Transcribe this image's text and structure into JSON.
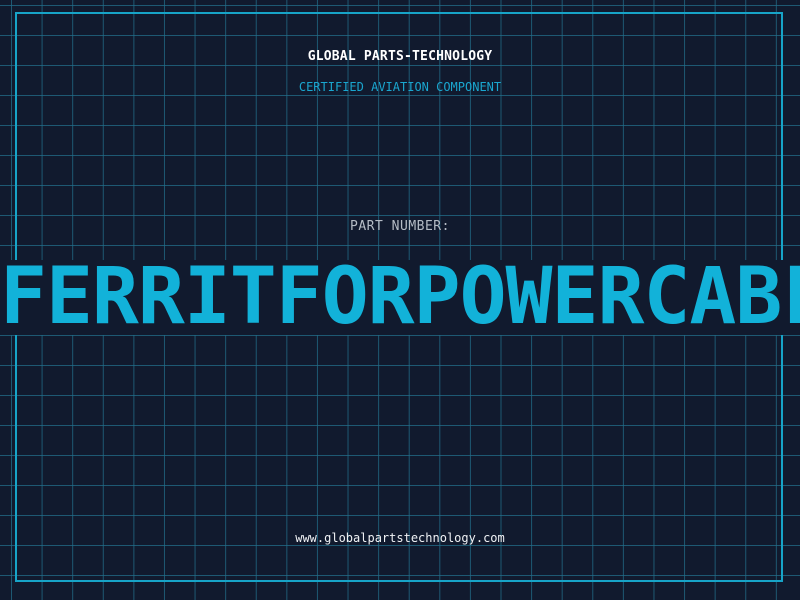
{
  "header": {
    "brand": "GLOBAL PARTS-TECHNOLOGY",
    "subtitle": "CERTIFIED AVIATION COMPONENT"
  },
  "part": {
    "label": "PART NUMBER:",
    "number": "FERRITFORPOWERCABLE"
  },
  "footer": {
    "url": "www.globalpartstechnology.com"
  },
  "colors": {
    "background": "#111a2e",
    "grid": "#226e8a",
    "accent": "#17a4c8",
    "text": "#ffffff"
  }
}
